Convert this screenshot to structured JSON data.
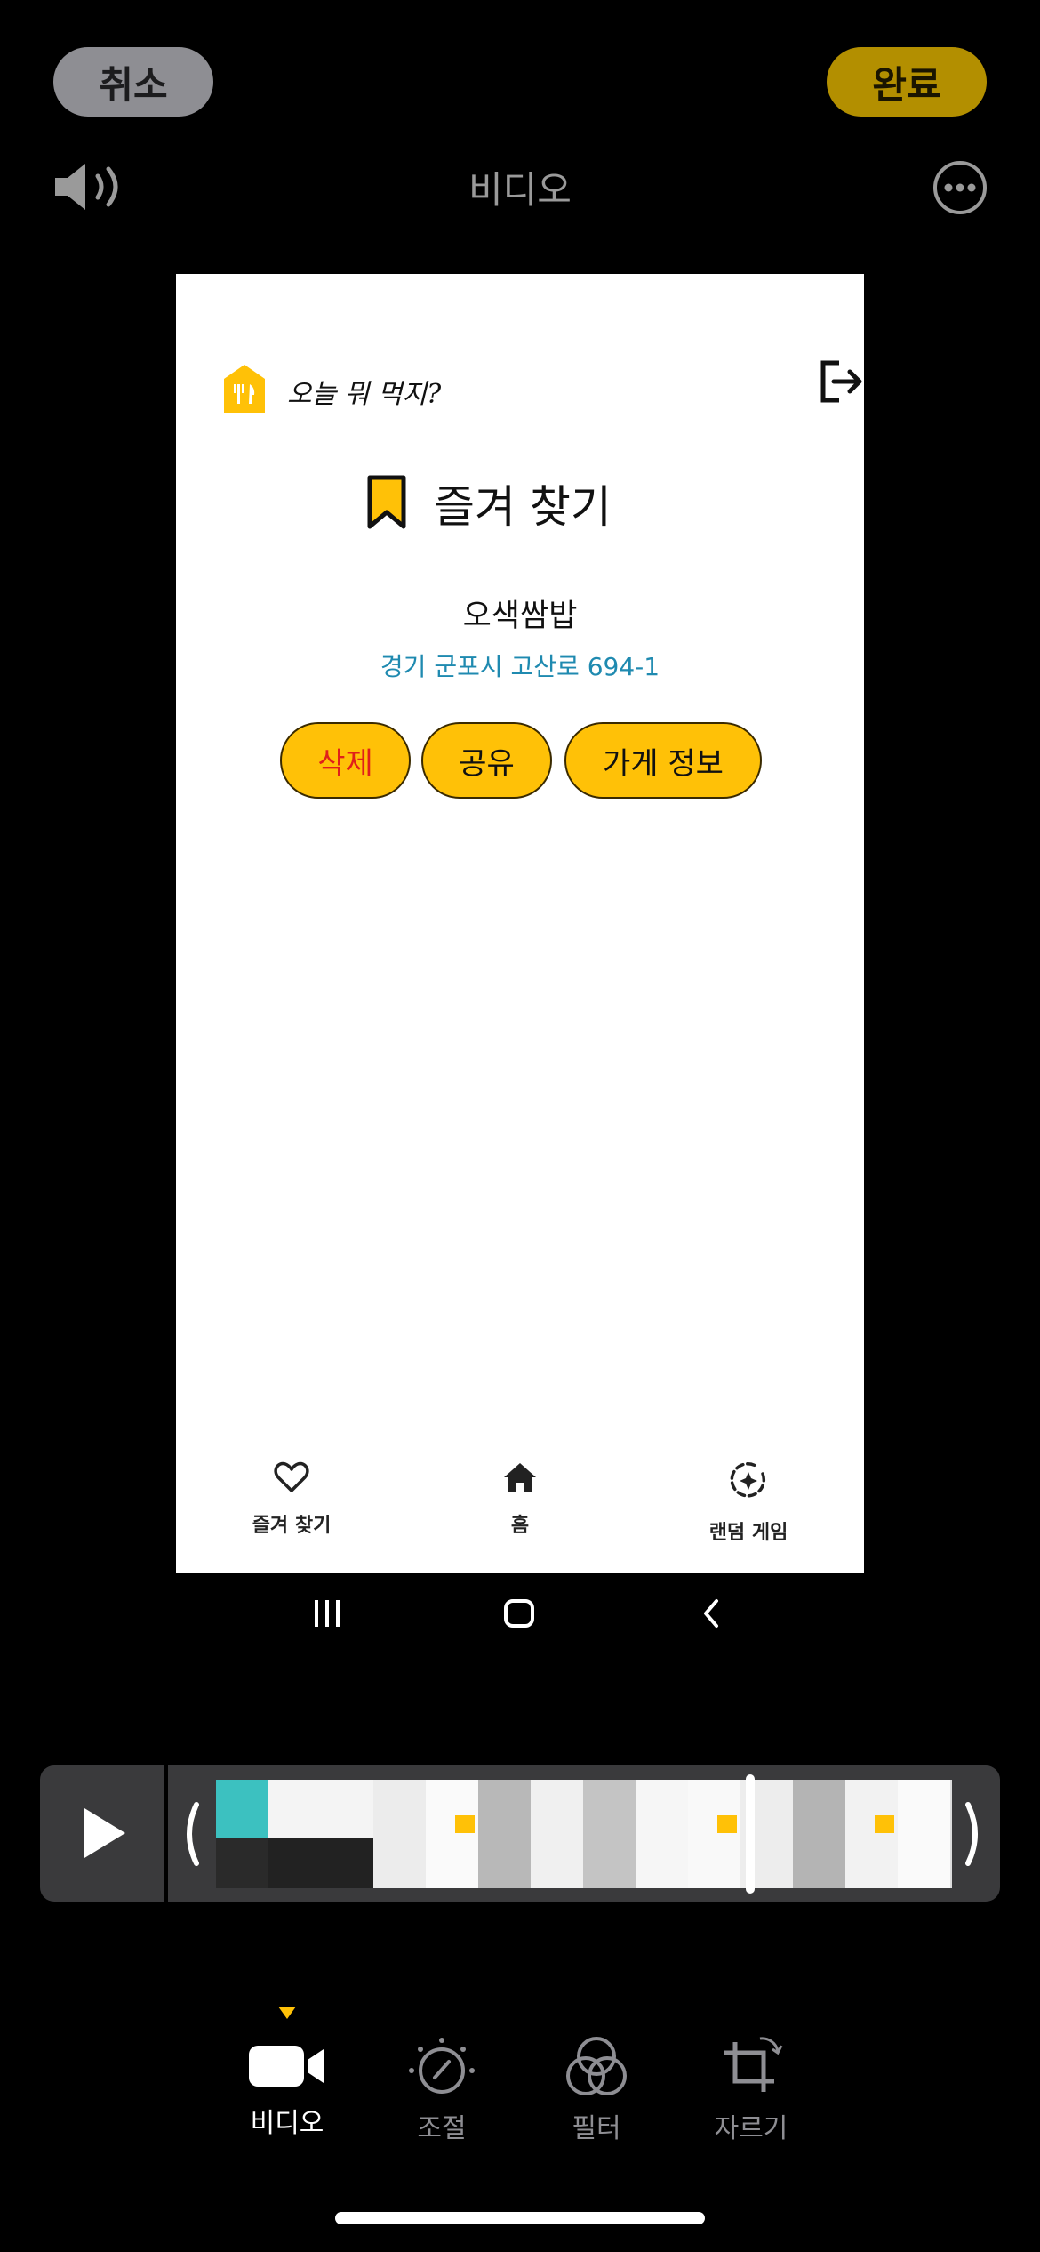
{
  "top_bar": {
    "cancel_label": "취소",
    "done_label": "완료",
    "title": "비디오"
  },
  "preview": {
    "app_title": "오늘 뭐 먹지?",
    "page_title": "즐겨 찾기",
    "restaurant": {
      "name": "오색쌈밥",
      "address": "경기 군포시 고산로 694-1"
    },
    "buttons": {
      "delete": "삭제",
      "share": "공유",
      "info": "가게 정보"
    },
    "bottom_nav": [
      {
        "label": "즐겨 찾기",
        "icon": "heart-icon"
      },
      {
        "label": "홈",
        "icon": "home-icon"
      },
      {
        "label": "랜덤 게임",
        "icon": "random-game-icon"
      }
    ],
    "colors": {
      "accent": "#ffc107",
      "delete_text": "#e0201a",
      "address_text": "#1f8ab0"
    }
  },
  "android_nav": {
    "icons": [
      "recent-apps-icon",
      "home-button-icon",
      "back-icon"
    ]
  },
  "timeline": {
    "icons": [
      "play-icon",
      "trim-start-handle",
      "trim-end-handle"
    ]
  },
  "tools": [
    {
      "label": "비디오",
      "icon": "video-camera-icon",
      "active": true
    },
    {
      "label": "조절",
      "icon": "adjust-dial-icon",
      "active": false
    },
    {
      "label": "필터",
      "icon": "filter-circles-icon",
      "active": false
    },
    {
      "label": "자르기",
      "icon": "crop-icon",
      "active": false
    }
  ],
  "colors": {
    "active_tool": "#ffffff",
    "inactive_tool": "#8e8e93",
    "selection_indicator": "#ffc107"
  }
}
